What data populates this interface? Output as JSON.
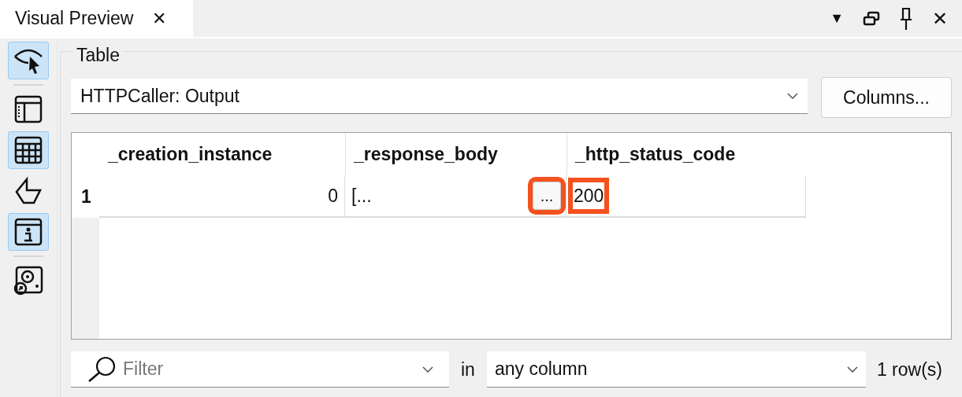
{
  "tab": {
    "title": "Visual Preview",
    "close": "✕"
  },
  "window_controls": {
    "menu": "▼",
    "close": "✕"
  },
  "toolbar": [
    {
      "kind": "eye",
      "selected": true,
      "separator_after": true
    },
    {
      "kind": "panel",
      "selected": false,
      "separator_after": false
    },
    {
      "kind": "table",
      "selected": true,
      "separator_after": false
    },
    {
      "kind": "shape",
      "selected": false,
      "separator_after": false
    },
    {
      "kind": "info",
      "selected": true,
      "separator_after": true
    },
    {
      "kind": "disc",
      "selected": false,
      "separator_after": false
    }
  ],
  "group_title": "Table",
  "source": {
    "value": "HTTPCaller: Output"
  },
  "columns_button": "Columns...",
  "table": {
    "columns": [
      "_creation_instance",
      "_response_body",
      "_http_status_code"
    ],
    "rows": [
      {
        "header": "1",
        "cells": [
          "0",
          "[...",
          "200"
        ],
        "cell_button": "...",
        "highlighted": true
      }
    ]
  },
  "filter": {
    "placeholder": "Filter",
    "in_label": "in",
    "scope": "any column",
    "row_count": "1 row(s)"
  }
}
